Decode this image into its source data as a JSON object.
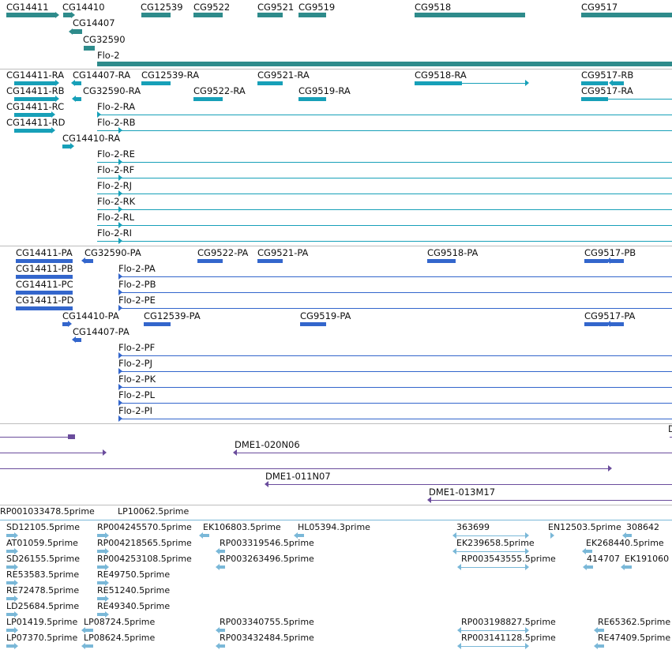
{
  "colors": {
    "genes": "#2e8b8b",
    "transcripts": "#17a0b8",
    "proteins": "#3366cc",
    "clones": "#6a4c9c",
    "ests": "#7ab8d8",
    "separator": "#bdbdbd"
  },
  "tracks": {
    "genes": {
      "features": [
        {
          "label": "CG14411",
          "id": "gene-cg14411"
        },
        {
          "label": "CG14410",
          "id": "gene-cg14410"
        },
        {
          "label": "CG12539",
          "id": "gene-cg12539"
        },
        {
          "label": "CG9522",
          "id": "gene-cg9522"
        },
        {
          "label": "CG9521",
          "id": "gene-cg9521"
        },
        {
          "label": "CG9519",
          "id": "gene-cg9519"
        },
        {
          "label": "CG9518",
          "id": "gene-cg9518"
        },
        {
          "label": "CG9517",
          "id": "gene-cg9517"
        },
        {
          "label": "CG14407",
          "id": "gene-cg14407"
        },
        {
          "label": "CG32590",
          "id": "gene-cg32590"
        },
        {
          "label": "Flo-2",
          "id": "gene-flo-2"
        }
      ]
    },
    "transcripts": {
      "features": [
        {
          "label": "CG14411-RA"
        },
        {
          "label": "CG14407-RA"
        },
        {
          "label": "CG12539-RA"
        },
        {
          "label": "CG9521-RA"
        },
        {
          "label": "CG9518-RA"
        },
        {
          "label": "CG9517-RB"
        },
        {
          "label": "CG14411-RB"
        },
        {
          "label": "CG32590-RA"
        },
        {
          "label": "CG9522-RA"
        },
        {
          "label": "CG9519-RA"
        },
        {
          "label": "CG9517-RA"
        },
        {
          "label": "CG14411-RC"
        },
        {
          "label": "Flo-2-RA"
        },
        {
          "label": "CG14411-RD"
        },
        {
          "label": "Flo-2-RB"
        },
        {
          "label": "CG14410-RA"
        },
        {
          "label": "Flo-2-RE"
        },
        {
          "label": "Flo-2-RF"
        },
        {
          "label": "Flo-2-RJ"
        },
        {
          "label": "Flo-2-RK"
        },
        {
          "label": "Flo-2-RL"
        },
        {
          "label": "Flo-2-RI"
        }
      ]
    },
    "proteins": {
      "features": [
        {
          "label": "CG14411-PA"
        },
        {
          "label": "CG32590-PA"
        },
        {
          "label": "CG9522-PA"
        },
        {
          "label": "CG9521-PA"
        },
        {
          "label": "CG9518-PA"
        },
        {
          "label": "CG9517-PB"
        },
        {
          "label": "CG14411-PB"
        },
        {
          "label": "Flo-2-PA"
        },
        {
          "label": "CG14411-PC"
        },
        {
          "label": "Flo-2-PB"
        },
        {
          "label": "CG14411-PD"
        },
        {
          "label": "Flo-2-PE"
        },
        {
          "label": "CG14410-PA"
        },
        {
          "label": "CG12539-PA"
        },
        {
          "label": "CG9519-PA"
        },
        {
          "label": "CG9517-PA"
        },
        {
          "label": "CG14407-PA"
        },
        {
          "label": "Flo-2-PF"
        },
        {
          "label": "Flo-2-PJ"
        },
        {
          "label": "Flo-2-PK"
        },
        {
          "label": "Flo-2-PL"
        },
        {
          "label": "Flo-2-PI"
        }
      ]
    },
    "clones": {
      "features": [
        {
          "label": "DME1-020N06"
        },
        {
          "label": "DME1-011N07"
        },
        {
          "label": "DME1-013M17"
        },
        {
          "label": "D"
        }
      ]
    },
    "ests": {
      "features": [
        {
          "label": "RP001033478.5prime"
        },
        {
          "label": "LP10062.5prime"
        },
        {
          "label": "SD12105.5prime"
        },
        {
          "label": "RP004245570.5prime"
        },
        {
          "label": "EK106803.5prime"
        },
        {
          "label": "HL05394.3prime"
        },
        {
          "label": "363699"
        },
        {
          "label": "EN12503.5prime"
        },
        {
          "label": "308642"
        },
        {
          "label": "AT01059.5prime"
        },
        {
          "label": "RP004218565.5prime"
        },
        {
          "label": "RP003319546.5prime"
        },
        {
          "label": "EK239658.5prime"
        },
        {
          "label": "EK268440.5prime"
        },
        {
          "label": "SD26155.5prime"
        },
        {
          "label": "RP004253108.5prime"
        },
        {
          "label": "RP003263496.5prime"
        },
        {
          "label": "RP003543555.5prime"
        },
        {
          "label": "414707"
        },
        {
          "label": "EK191060"
        },
        {
          "label": "RE53583.5prime"
        },
        {
          "label": "RE49750.5prime"
        },
        {
          "label": "RE72478.5prime"
        },
        {
          "label": "RE51240.5prime"
        },
        {
          "label": "LD25684.5prime"
        },
        {
          "label": "RE49340.5prime"
        },
        {
          "label": "LP01419.5prime"
        },
        {
          "label": "LP08724.5prime"
        },
        {
          "label": "RP003340755.5prime"
        },
        {
          "label": "RP003198827.5prime"
        },
        {
          "label": "RE65362.5prime"
        },
        {
          "label": "LP07370.5prime"
        },
        {
          "label": "LP08624.5prime"
        },
        {
          "label": "RP003432484.5prime"
        },
        {
          "label": "RP003141128.5prime"
        },
        {
          "label": "RE47409.5prime"
        }
      ]
    }
  }
}
